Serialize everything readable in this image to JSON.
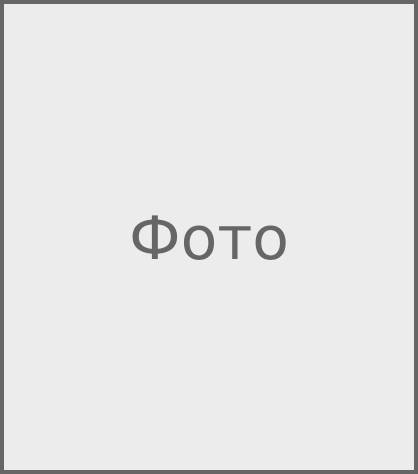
{
  "placeholder": {
    "label": "Фото",
    "colors": {
      "background": "#ececec",
      "border": "#666666",
      "text": "#666666"
    }
  }
}
